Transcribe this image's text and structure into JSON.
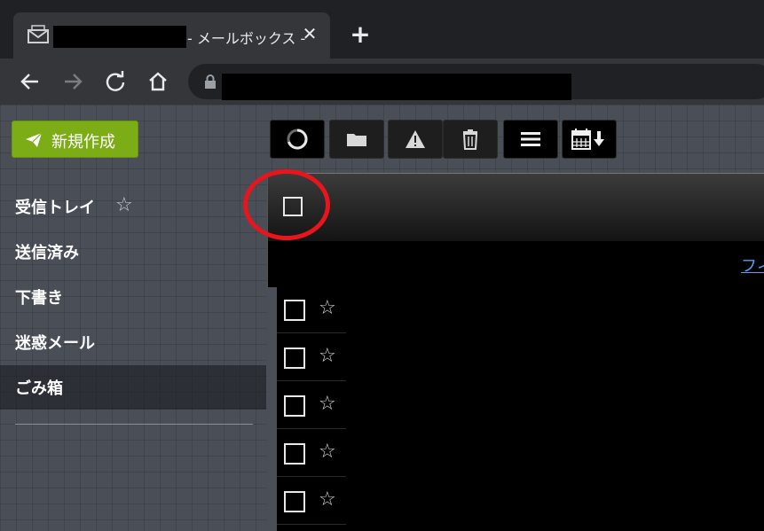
{
  "browser": {
    "tab_title": "- メールボックス -",
    "close_glyph": "✕",
    "new_tab_glyph": "+"
  },
  "toolbar_icons": [
    "back-icon",
    "forward-icon",
    "reload-icon",
    "home-icon",
    "lock-icon"
  ],
  "compose": {
    "label": "新規作成",
    "icon": "paper-plane-icon",
    "color": "#7cad17"
  },
  "folders": [
    {
      "label": "受信トレイ",
      "starred": true
    },
    {
      "label": "送信済み"
    },
    {
      "label": "下書き"
    },
    {
      "label": "迷惑メール"
    },
    {
      "label": "ごみ箱",
      "active": true
    }
  ],
  "folder_star_glyph": "☆",
  "action_buttons": [
    "refresh-icon",
    "folder-icon",
    "warning-icon",
    "trash-icon",
    "menu-icon",
    "calendar-download-icon"
  ],
  "list": {
    "filter_link": "フィ",
    "rows": [
      {
        "star": "☆"
      },
      {
        "star": "☆"
      },
      {
        "star": "☆"
      },
      {
        "star": "☆"
      },
      {
        "star": "☆"
      }
    ]
  },
  "annotation_color": "#e8151c"
}
